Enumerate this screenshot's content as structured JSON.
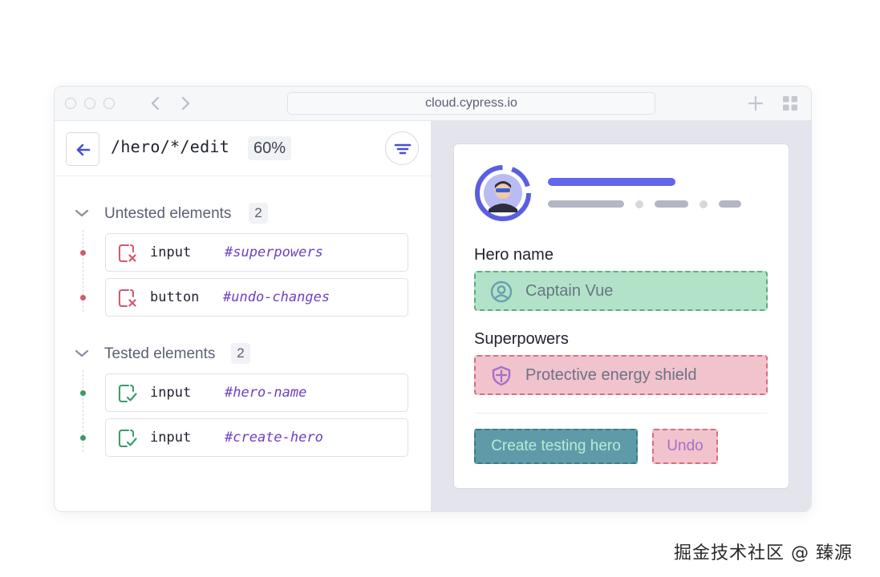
{
  "browser": {
    "url": "cloud.cypress.io",
    "icons": [
      "back-nav-icon",
      "forward-nav-icon",
      "new-tab-plus-icon",
      "tab-grid-icon"
    ]
  },
  "left_panel": {
    "back_icon": "arrow-left-icon",
    "route": "/hero/*/edit",
    "coverage": "60%",
    "filter_icon": "filter-icon",
    "sections": [
      {
        "title": "Untested elements",
        "count": "2",
        "status": "untested",
        "items": [
          {
            "type": "input",
            "selector": "#superpowers"
          },
          {
            "type": "button",
            "selector": "#undo-changes"
          }
        ]
      },
      {
        "title": "Tested elements",
        "count": "2",
        "status": "tested",
        "items": [
          {
            "type": "input",
            "selector": "#hero-name"
          },
          {
            "type": "input",
            "selector": "#create-hero"
          }
        ]
      }
    ]
  },
  "preview": {
    "hero_name_label": "Hero name",
    "hero_name_value": "Captain Vue",
    "superpowers_label": "Superpowers",
    "superpowers_value": "Protective energy shield",
    "create_button": "Create testing hero",
    "undo_button": "Undo"
  },
  "colors": {
    "accent": "#5a5fe0",
    "untested": "#d2596f",
    "tested": "#3c9a6a",
    "selector": "#6e3fc4"
  },
  "watermark": "掘金技术社区 @ 臻源"
}
